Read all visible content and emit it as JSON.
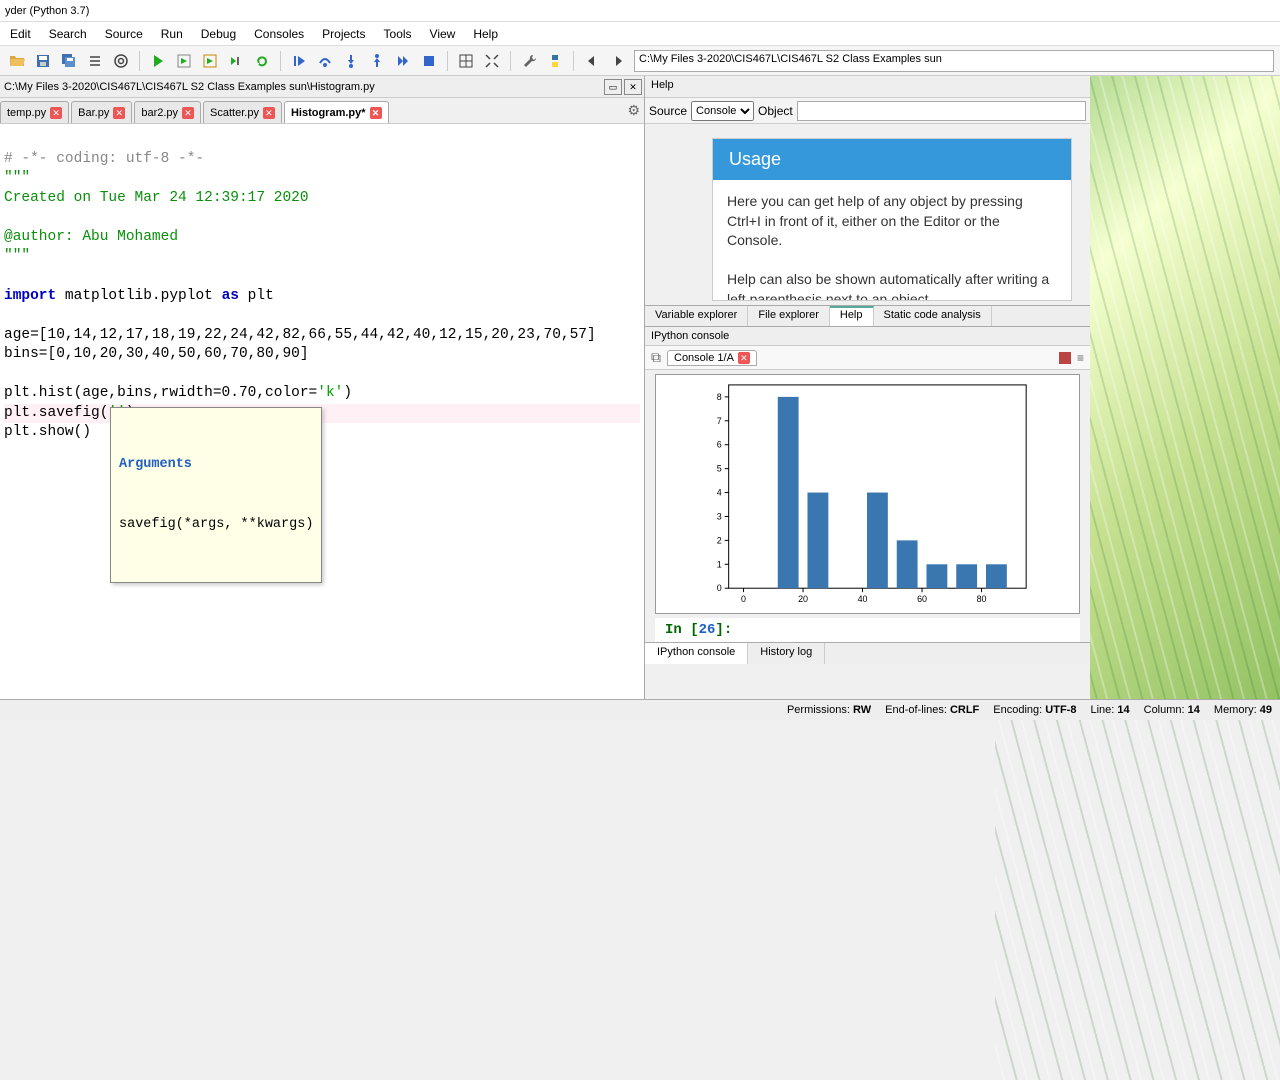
{
  "window": {
    "title": "yder (Python 3.7)"
  },
  "menu": [
    "Edit",
    "Search",
    "Source",
    "Run",
    "Debug",
    "Consoles",
    "Projects",
    "Tools",
    "View",
    "Help"
  ],
  "toolbar_path": "C:\\My Files 3-2020\\CIS467L\\CIS467L S2 Class Examples sun",
  "editor": {
    "filepath": "C:\\My Files 3-2020\\CIS467L\\CIS467L S2 Class Examples sun\\Histogram.py",
    "tabs": [
      {
        "name": "temp.py",
        "dirty": false
      },
      {
        "name": "Bar.py",
        "dirty": false
      },
      {
        "name": "bar2.py",
        "dirty": false
      },
      {
        "name": "Scatter.py",
        "dirty": false
      },
      {
        "name": "Histogram.py*",
        "dirty": true,
        "active": true
      }
    ],
    "lines": {
      "l1": "# -*- coding: utf-8 -*-",
      "l2": "\"\"\"",
      "l3": "Created on Tue Mar 24 12:39:17 2020",
      "l4": "",
      "l5": "@author: Abu Mohamed",
      "l6": "\"\"\"",
      "l7": "",
      "l8_kw": "import ",
      "l8_rest": "matplotlib.pyplot ",
      "l8_kw2": "as ",
      "l8_rest2": "plt",
      "l9": "",
      "l10": "age=[10,14,12,17,18,19,22,24,42,82,66,55,44,42,40,12,15,20,23,70,57]",
      "l11": "bins=[0,10,20,30,40,50,60,70,80,90]",
      "l12": "",
      "l13a": "plt.hist(age,bins,rwidth=0.70,color=",
      "l13b": "'k'",
      "l13c": ")",
      "l14a": "plt.savefig(",
      "l14b": "''",
      "l14c": ")",
      "l15": "plt.show()"
    },
    "tooltip": {
      "header": "Arguments",
      "sig": "savefig(*args, **kwargs)"
    }
  },
  "help": {
    "title": "Help",
    "source_label": "Source",
    "source_value": "Console",
    "object_label": "Object",
    "usage_header": "Usage",
    "usage_body1": "Here you can get help of any object by pressing Ctrl+I in front of it, either on the Editor or the Console.",
    "usage_body2": "Help can also be shown automatically after writing a left parenthesis next to an object."
  },
  "mid_tabs": [
    "Variable explorer",
    "File explorer",
    "Help",
    "Static code analysis"
  ],
  "mid_active": "Help",
  "console": {
    "header": "IPython console",
    "tab": "Console 1/A",
    "prompt_in": "In [",
    "prompt_num": "26",
    "prompt_end": "]:"
  },
  "bottom_tabs": [
    "IPython console",
    "History log"
  ],
  "bottom_active": "IPython console",
  "status": {
    "perm_label": "Permissions:",
    "perm_val": "RW",
    "eol_label": "End-of-lines:",
    "eol_val": "CRLF",
    "enc_label": "Encoding:",
    "enc_val": "UTF-8",
    "line_label": "Line:",
    "line_val": "14",
    "col_label": "Column:",
    "col_val": "14",
    "mem_label": "Memory:",
    "mem_val": "49"
  },
  "chart_data": {
    "type": "bar",
    "title": "",
    "xlabel": "",
    "ylabel": "",
    "x_ticks": [
      0,
      20,
      40,
      60,
      80
    ],
    "y_ticks": [
      0,
      1,
      2,
      3,
      4,
      5,
      6,
      7,
      8
    ],
    "ylim": [
      0,
      8.5
    ],
    "xlim": [
      -5,
      95
    ],
    "bin_edges": [
      0,
      10,
      20,
      30,
      40,
      50,
      60,
      70,
      80,
      90
    ],
    "counts": [
      0,
      8,
      4,
      0,
      4,
      2,
      1,
      1,
      1
    ],
    "rwidth": 0.7,
    "color": "#3a76af"
  }
}
